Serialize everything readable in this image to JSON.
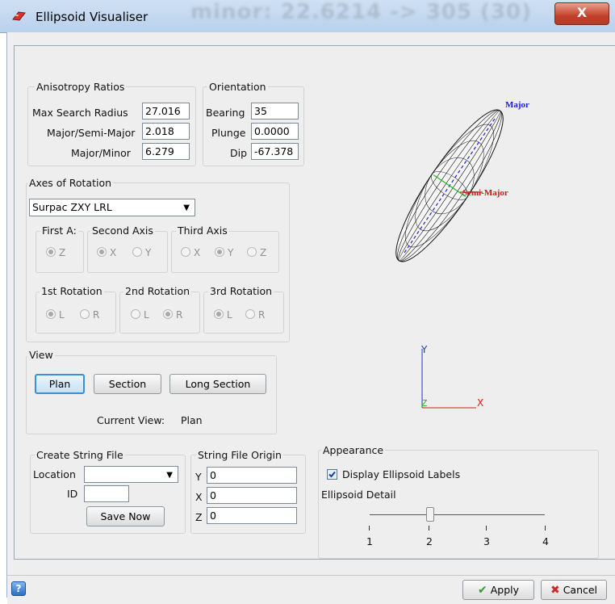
{
  "window": {
    "title": "Ellipsoid Visualiser",
    "background_text": "minor: 22.6214 -> 305 (30)",
    "close_label": "X"
  },
  "anisotropy": {
    "label": "Anisotropy Ratios",
    "max_search_radius_label": "Max Search Radius",
    "max_search_radius": "27.016",
    "major_semi_major_label": "Major/Semi-Major",
    "major_semi_major": "2.018",
    "major_minor_label": "Major/Minor",
    "major_minor": "6.279"
  },
  "orientation": {
    "label": "Orientation",
    "bearing_label": "Bearing",
    "bearing": "35",
    "plunge_label": "Plunge",
    "plunge": "0.0000",
    "dip_label": "Dip",
    "dip": "-67.378"
  },
  "axes": {
    "label": "Axes of Rotation",
    "selected": "Surpac ZXY LRL",
    "first_axis_label": "First A:",
    "first_axis_options": [
      "Z"
    ],
    "second_axis_label": "Second Axis",
    "second_axis_options": [
      "X",
      "Y"
    ],
    "third_axis_label": "Third Axis",
    "third_axis_options": [
      "X",
      "Y",
      "Z"
    ],
    "rot1_label": "1st Rotation",
    "rot2_label": "2nd Rotation",
    "rot3_label": "3rd Rotation",
    "rot_options": [
      "L",
      "R"
    ]
  },
  "view": {
    "label": "View",
    "plan_label": "Plan",
    "section_label": "Section",
    "long_section_label": "Long Section",
    "current_view_label": "Current View:",
    "current_view": "Plan"
  },
  "string_file": {
    "label": "Create String File",
    "location_label": "Location",
    "location_value": "",
    "id_label": "ID",
    "id_value": "",
    "save_label": "Save Now"
  },
  "origin": {
    "label": "String File Origin",
    "y_label": "Y",
    "y": "0",
    "x_label": "X",
    "x": "0",
    "z_label": "Z",
    "z": "0"
  },
  "appearance": {
    "label": "Appearance",
    "display_labels": "Display Ellipsoid Labels",
    "display_labels_checked": true,
    "detail_label": "Ellipsoid Detail",
    "detail_ticks": [
      "1",
      "2",
      "3",
      "4"
    ],
    "detail_value": 2
  },
  "visual": {
    "major_label": "Major",
    "semi_major_label": "Semi-Major",
    "axis_y": "Y",
    "axis_x": "X",
    "axis_z": "Z",
    "major_color": "#1f1fd6",
    "semi_color": "#d21a1a",
    "minor_color": "#22bb22"
  },
  "footer": {
    "help_icon": "help-icon",
    "apply_label": "Apply",
    "cancel_label": "Cancel"
  }
}
